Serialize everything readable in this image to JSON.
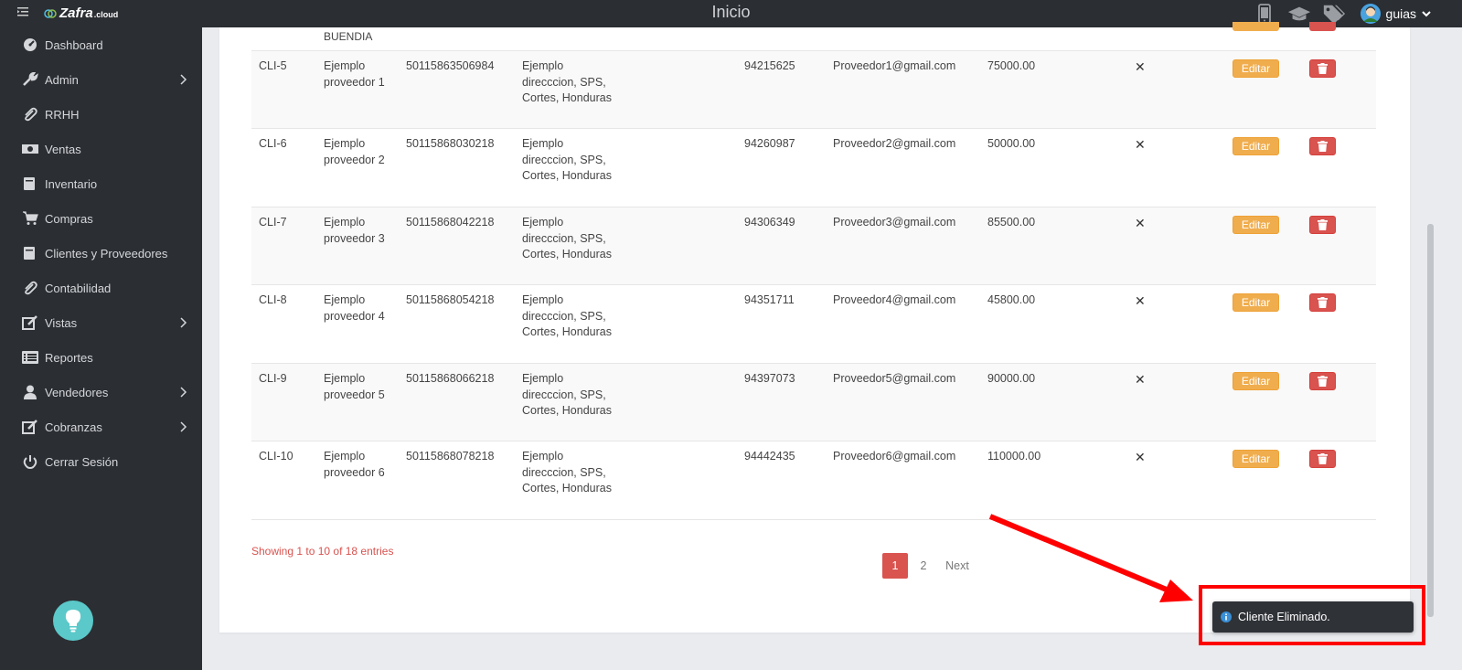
{
  "topbar": {
    "brand": "Zafra",
    "brand_suffix": ".cloud",
    "title": "Inicio",
    "icons": [
      "mobile-icon",
      "graduation-cap-icon",
      "tags-icon"
    ],
    "user_name": "guias"
  },
  "sidebar": {
    "items": [
      {
        "label": "Dashboard",
        "icon": "dashboard-icon",
        "has_submenu": false
      },
      {
        "label": "Admin",
        "icon": "wrench-icon",
        "has_submenu": true
      },
      {
        "label": "RRHH",
        "icon": "paperclip-icon",
        "has_submenu": false
      },
      {
        "label": "Ventas",
        "icon": "money-icon",
        "has_submenu": false
      },
      {
        "label": "Inventario",
        "icon": "book-icon",
        "has_submenu": false
      },
      {
        "label": "Compras",
        "icon": "cart-icon",
        "has_submenu": false
      },
      {
        "label": "Clientes y Proveedores",
        "icon": "book-icon",
        "has_submenu": false
      },
      {
        "label": "Contabilidad",
        "icon": "paperclip-icon",
        "has_submenu": false
      },
      {
        "label": "Vistas",
        "icon": "edit-icon",
        "has_submenu": true
      },
      {
        "label": "Reportes",
        "icon": "list-icon",
        "has_submenu": false
      },
      {
        "label": "Vendedores",
        "icon": "user-icon",
        "has_submenu": true
      },
      {
        "label": "Cobranzas",
        "icon": "edit-icon",
        "has_submenu": true
      },
      {
        "label": "Cerrar Sesión",
        "icon": "power-icon",
        "has_submenu": false
      }
    ]
  },
  "table": {
    "partial_row_name": "BUENDIA",
    "rows": [
      {
        "code": "CLI-5",
        "name": "Ejemplo proveedor 1",
        "rtn": "50115863506984",
        "address": "Ejemplo direcccion, SPS, Cortes, Honduras",
        "phone": "94215625",
        "email": "Proveedor1@gmail.com",
        "credit": "75000.00",
        "flag": "✕",
        "edit_label": "Editar"
      },
      {
        "code": "CLI-6",
        "name": "Ejemplo proveedor 2",
        "rtn": "50115868030218",
        "address": "Ejemplo direcccion, SPS, Cortes, Honduras",
        "phone": "94260987",
        "email": "Proveedor2@gmail.com",
        "credit": "50000.00",
        "flag": "✕",
        "edit_label": "Editar"
      },
      {
        "code": "CLI-7",
        "name": "Ejemplo proveedor 3",
        "rtn": "50115868042218",
        "address": "Ejemplo direcccion, SPS, Cortes, Honduras",
        "phone": "94306349",
        "email": "Proveedor3@gmail.com",
        "credit": "85500.00",
        "flag": "✕",
        "edit_label": "Editar"
      },
      {
        "code": "CLI-8",
        "name": "Ejemplo proveedor 4",
        "rtn": "50115868054218",
        "address": "Ejemplo direcccion, SPS, Cortes, Honduras",
        "phone": "94351711",
        "email": "Proveedor4@gmail.com",
        "credit": "45800.00",
        "flag": "✕",
        "edit_label": "Editar"
      },
      {
        "code": "CLI-9",
        "name": "Ejemplo proveedor 5",
        "rtn": "50115868066218",
        "address": "Ejemplo direcccion, SPS, Cortes, Honduras",
        "phone": "94397073",
        "email": "Proveedor5@gmail.com",
        "credit": "90000.00",
        "flag": "✕",
        "edit_label": "Editar"
      },
      {
        "code": "CLI-10",
        "name": "Ejemplo proveedor 6",
        "rtn": "50115868078218",
        "address": "Ejemplo direcccion, SPS, Cortes, Honduras",
        "phone": "94442435",
        "email": "Proveedor6@gmail.com",
        "credit": "110000.00",
        "flag": "✕",
        "edit_label": "Editar"
      }
    ]
  },
  "footer": {
    "entries_info": "Showing 1 to 10 of 18 entries",
    "pages": [
      "1",
      "2"
    ],
    "current_page": "1",
    "next_label": "Next"
  },
  "toast": {
    "message": "Cliente Eliminado.",
    "icon": "info-icon"
  },
  "colors": {
    "sidebar_bg": "#2b2e33",
    "edit_button": "#f0ad4e",
    "delete_button": "#d9534f",
    "annotation": "#ff0000",
    "bulb": "#5bc8c9"
  }
}
